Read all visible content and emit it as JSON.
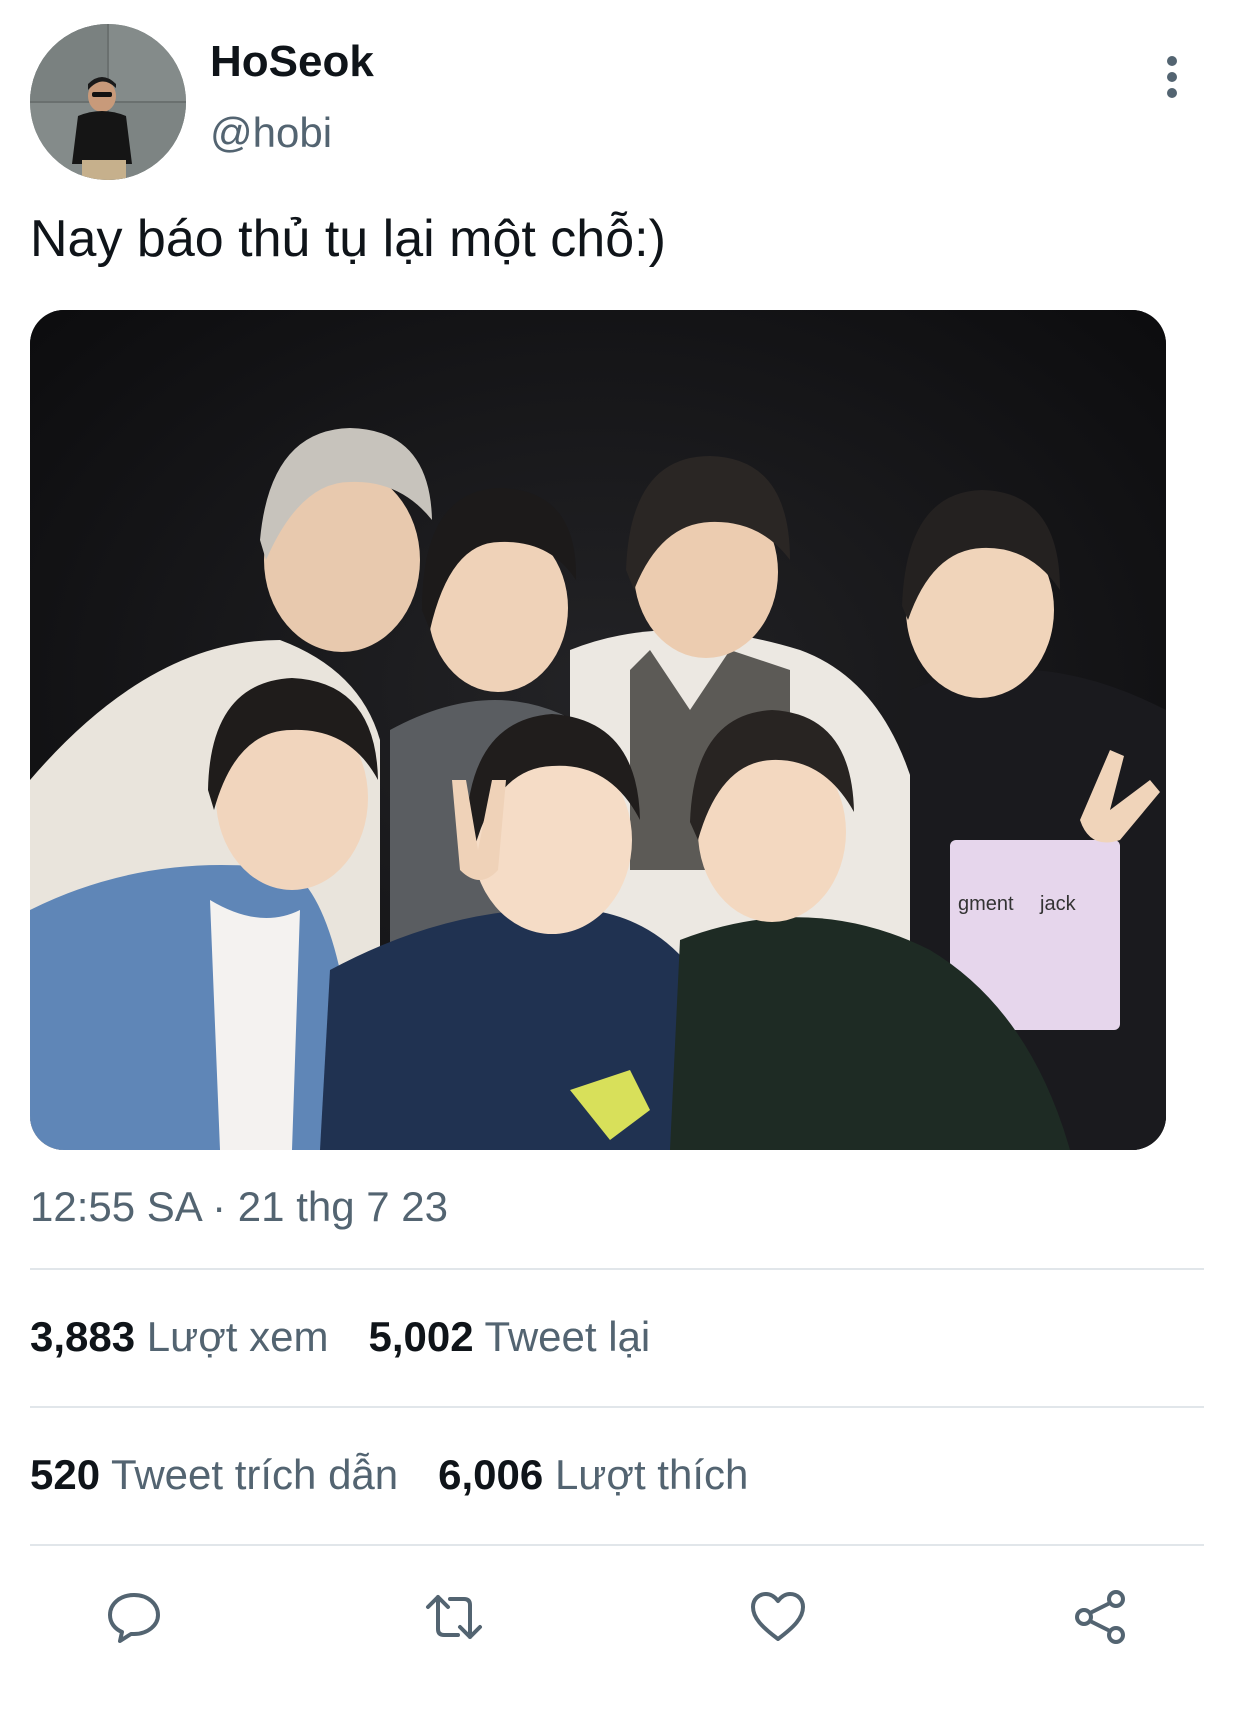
{
  "author": {
    "display_name": "HoSeok",
    "handle": "@hobi"
  },
  "tweet": {
    "text": "Nay báo thủ tụ lại một chỗ:)",
    "timestamp": "12:55 SA · 21 thg 7 23"
  },
  "stats": {
    "views": {
      "count": "3,883",
      "label": "Lượt xem"
    },
    "retweets": {
      "count": "5,002",
      "label": "Tweet lại"
    },
    "quotes": {
      "count": "520",
      "label": "Tweet trích dẫn"
    },
    "likes": {
      "count": "6,006",
      "label": "Lượt thích"
    }
  },
  "media": {
    "shirt_text_1": "gment",
    "shirt_text_2": "jack"
  },
  "icons": {
    "more": "more-vertical-icon",
    "reply": "reply-icon",
    "retweet": "retweet-icon",
    "like": "heart-icon",
    "share": "share-icon"
  },
  "colors": {
    "primary_text": "#0f1419",
    "secondary_text": "#536471",
    "divider": "#e1e6ea"
  }
}
